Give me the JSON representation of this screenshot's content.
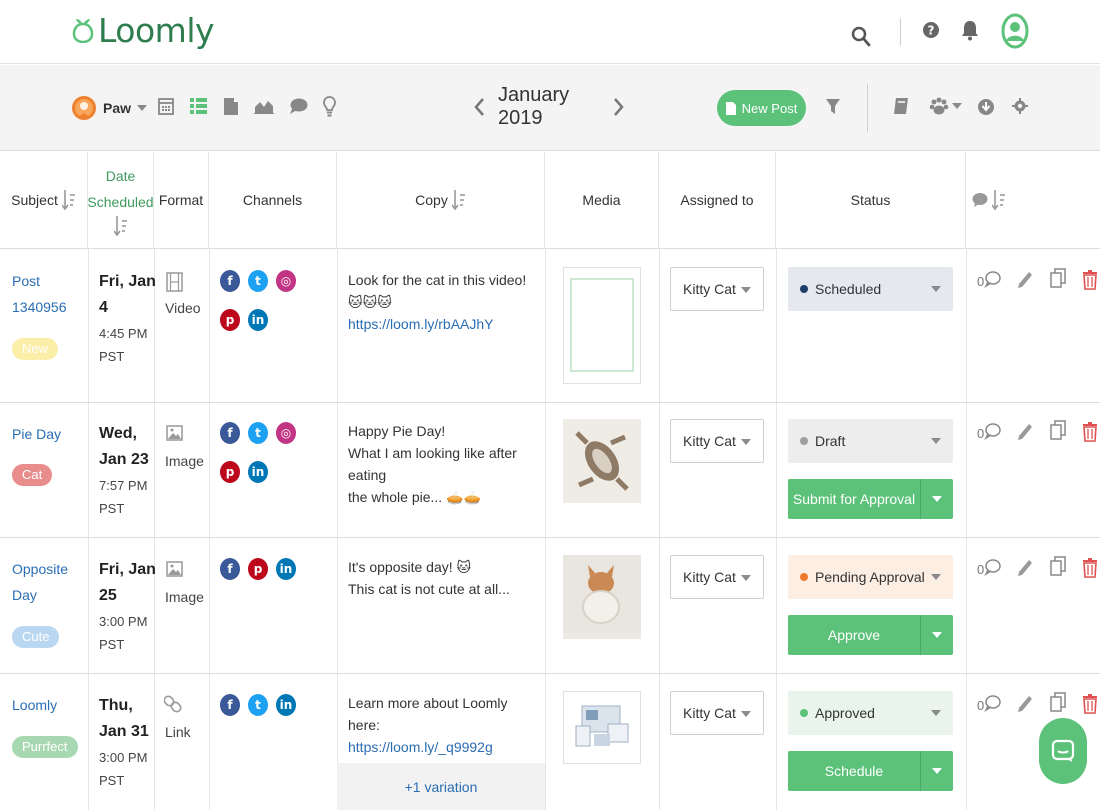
{
  "app": {
    "logo_text": "Loomly",
    "brand_color": "#2e7d4f",
    "accent_color": "#5cc27a"
  },
  "topbar": {
    "icons": [
      "search-icon",
      "help-icon",
      "bell-icon",
      "user-avatar-icon"
    ]
  },
  "toolbar": {
    "calendar_name": "Paw",
    "views": [
      "calendar-icon",
      "list-view-icon",
      "post-ideas-icon",
      "analytics-icon",
      "comments-icon",
      "lightbulb-icon"
    ],
    "month_label": "January 2019",
    "new_post_label": "New Post",
    "right_icons": [
      "filter-icon",
      "library-icon",
      "team-icon",
      "download-icon",
      "settings-icon"
    ]
  },
  "table": {
    "headers": {
      "subject": "Subject",
      "date_line1": "Date",
      "date_line2": "Scheduled",
      "format": "Format",
      "channels": "Channels",
      "copy": "Copy",
      "media": "Media",
      "assigned": "Assigned to",
      "status": "Status"
    },
    "rows": [
      {
        "subject_line1": "Post",
        "subject_line2": "1340956",
        "tag": "New",
        "tag_color": "#f9e79f",
        "date_line1": "Fri, Jan",
        "date_line2": "4",
        "time_line1": "4:45 PM",
        "time_line2": "PST",
        "format": "Video",
        "channels": [
          "facebook",
          "twitter",
          "instagram",
          "pinterest",
          "linkedin"
        ],
        "copy_line1": "Look for the cat in this video! 🐱🐱🐱",
        "copy_line2": "https://loom.ly/rbAAJhY",
        "assigned": "Kitty Cat",
        "status": "Scheduled",
        "status_color": "#1f3c66",
        "status_bg": "#e6e8ef",
        "comments": "0"
      },
      {
        "subject_line1": "Pie Day",
        "tag": "Cat",
        "tag_color": "#e98c8c",
        "date_line1": "Wed,",
        "date_line2": "Jan 23",
        "time_line1": "7:57 PM",
        "time_line2": "PST",
        "format": "Image",
        "channels": [
          "facebook",
          "twitter",
          "instagram",
          "pinterest",
          "linkedin"
        ],
        "copy_line1": "Happy Pie Day!",
        "copy_line2": "What I am looking like after eating",
        "copy_line3": "the whole pie... 🥧🥧",
        "assigned": "Kitty Cat",
        "status": "Draft",
        "status_color": "#9e9e9e",
        "status_bg": "#ededed",
        "action": "Submit for Approval",
        "comments": "0"
      },
      {
        "subject_line1": "Opposite",
        "subject_line2": "Day",
        "tag": "Cute",
        "tag_color": "#b9d7f0",
        "date_line1": "Fri, Jan",
        "date_line2": "25",
        "time_line1": "3:00 PM",
        "time_line2": "PST",
        "format": "Image",
        "channels": [
          "facebook",
          "pinterest",
          "linkedin"
        ],
        "copy_line1": "It's opposite day! 🐱",
        "copy_line2": "This cat is not cute at all...",
        "assigned": "Kitty Cat",
        "status": "Pending Approval",
        "status_color": "#f07a2c",
        "status_bg": "#fdeee3",
        "action": "Approve",
        "comments": "0"
      },
      {
        "subject_line1": "Loomly",
        "tag": "Purrfect",
        "tag_color": "#a8d8b1",
        "date_line1": "Thu,",
        "date_line2": "Jan 31",
        "time_line1": "3:00 PM",
        "time_line2": "PST",
        "format": "Link",
        "channels": [
          "facebook",
          "twitter",
          "linkedin"
        ],
        "copy_line1": "Learn more about Loomly here:",
        "copy_line2": "https://loom.ly/_q9992g",
        "variation": "+1 variation",
        "assigned": "Kitty Cat",
        "status": "Approved",
        "status_color": "#5cc27a",
        "status_bg": "#e9f4ec",
        "action": "Schedule",
        "comments": "0"
      }
    ]
  }
}
